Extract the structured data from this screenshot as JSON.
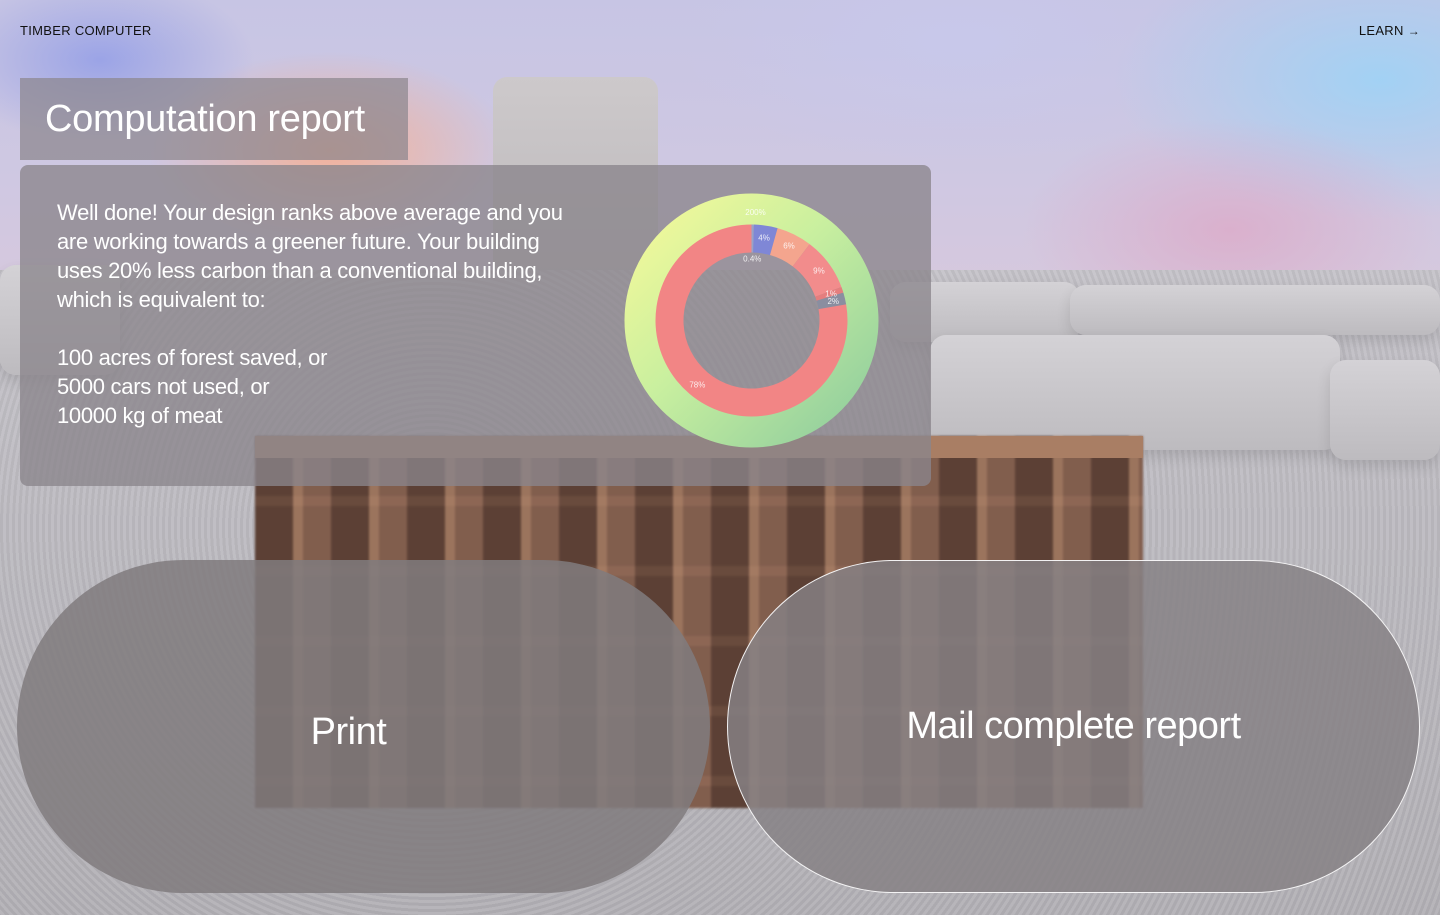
{
  "header": {
    "brand": "TIMBER COMPUTER",
    "learn_label": "LEARN",
    "learn_icon": "arrow-right-icon"
  },
  "title": "Computation report",
  "report": {
    "summary": "Well done! Your design ranks above average and you are working towards a greener future. Your building uses 20% less carbon than a conventional building, which is equivalent to:",
    "equivalents": [
      "100 acres of forest saved, or",
      "5000 cars not used, or",
      "10000 kg of meat"
    ]
  },
  "chart_data": {
    "type": "pie",
    "outer_ring": {
      "label": "200%",
      "colors": [
        "#eef5a0",
        "#8fcf9c"
      ]
    },
    "inner_ring": {
      "slices": [
        {
          "label": "0.4%",
          "value": 0.4,
          "color": "#9aa3c8"
        },
        {
          "label": "4%",
          "value": 4,
          "color": "#7f87d6"
        },
        {
          "label": "6%",
          "value": 6,
          "color": "#f4a58e"
        },
        {
          "label": "9%",
          "value": 9,
          "color": "#f28c8c"
        },
        {
          "label": "1%",
          "value": 1,
          "color": "#e57e7e"
        },
        {
          "label": "2%",
          "value": 2,
          "color": "#8a8ea0"
        },
        {
          "label": "78%",
          "value": 78,
          "color": "#f28585"
        }
      ]
    }
  },
  "buttons": {
    "print": "Print",
    "mail": "Mail complete report"
  }
}
